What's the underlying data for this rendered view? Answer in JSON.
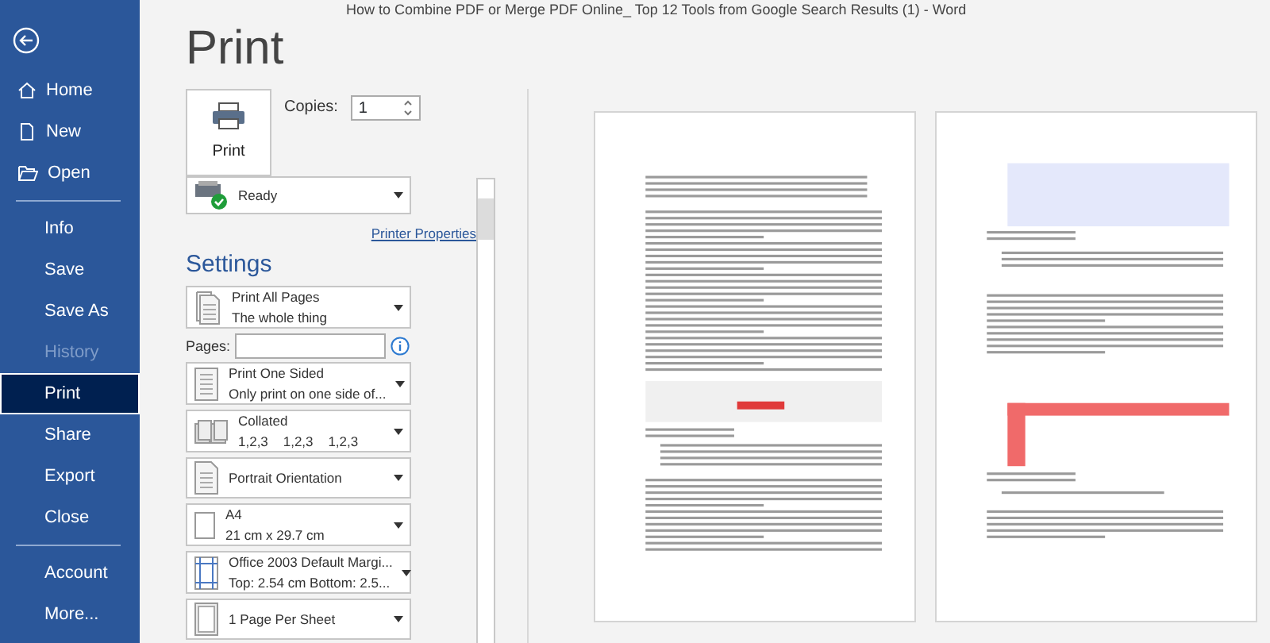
{
  "window": {
    "title": "How to Combine PDF or Merge PDF Online_ Top 12 Tools from Google Search Results (1) - Word"
  },
  "sidebar": {
    "items": [
      {
        "kind": "back"
      },
      {
        "kind": "nav",
        "label": "Home",
        "selected": false,
        "disabled": false
      },
      {
        "kind": "nav",
        "label": "New",
        "selected": false,
        "disabled": false
      },
      {
        "kind": "nav",
        "label": "Open",
        "selected": false,
        "disabled": false
      },
      {
        "kind": "divider"
      },
      {
        "kind": "nav",
        "label": "Info",
        "selected": false,
        "disabled": false
      },
      {
        "kind": "nav",
        "label": "Save",
        "selected": false,
        "disabled": false
      },
      {
        "kind": "nav",
        "label": "Save As",
        "selected": false,
        "disabled": false
      },
      {
        "kind": "nav",
        "label": "History",
        "selected": false,
        "disabled": true
      },
      {
        "kind": "nav",
        "label": "Print",
        "selected": true,
        "disabled": false
      },
      {
        "kind": "nav",
        "label": "Share",
        "selected": false,
        "disabled": false
      },
      {
        "kind": "nav",
        "label": "Export",
        "selected": false,
        "disabled": false
      },
      {
        "kind": "nav",
        "label": "Close",
        "selected": false,
        "disabled": false
      },
      {
        "kind": "divider"
      },
      {
        "kind": "nav",
        "label": "Account",
        "selected": false,
        "disabled": false
      },
      {
        "kind": "nav",
        "label": "More...",
        "selected": false,
        "disabled": false
      }
    ]
  },
  "print": {
    "title": "Print",
    "button": "Print",
    "copies_label": "Copies:",
    "copies": "1",
    "printer": {
      "status": "Ready",
      "properties_link": "Printer Properties"
    },
    "settings_title": "Settings",
    "pages_label": "Pages:",
    "settings": [
      {
        "kind": "dropdown",
        "line1": "Print All Pages",
        "line2": "The whole thing"
      },
      {
        "kind": "pages"
      },
      {
        "kind": "dropdown",
        "line1": "Print One Sided",
        "line2": "Only print on one side of..."
      },
      {
        "kind": "dropdown",
        "line1": "Collated",
        "line2": "1,2,3    1,2,3    1,2,3"
      },
      {
        "kind": "dropdown",
        "line1": "Portrait Orientation"
      },
      {
        "kind": "dropdown",
        "line1": "A4",
        "line2": "21 cm x 29.7 cm"
      },
      {
        "kind": "dropdown",
        "line1": "Office 2003 Default Margi...",
        "line2": "Top: 2.54 cm Bottom: 2.5..."
      },
      {
        "kind": "dropdown",
        "line1": "1 Page Per Sheet"
      }
    ]
  }
}
